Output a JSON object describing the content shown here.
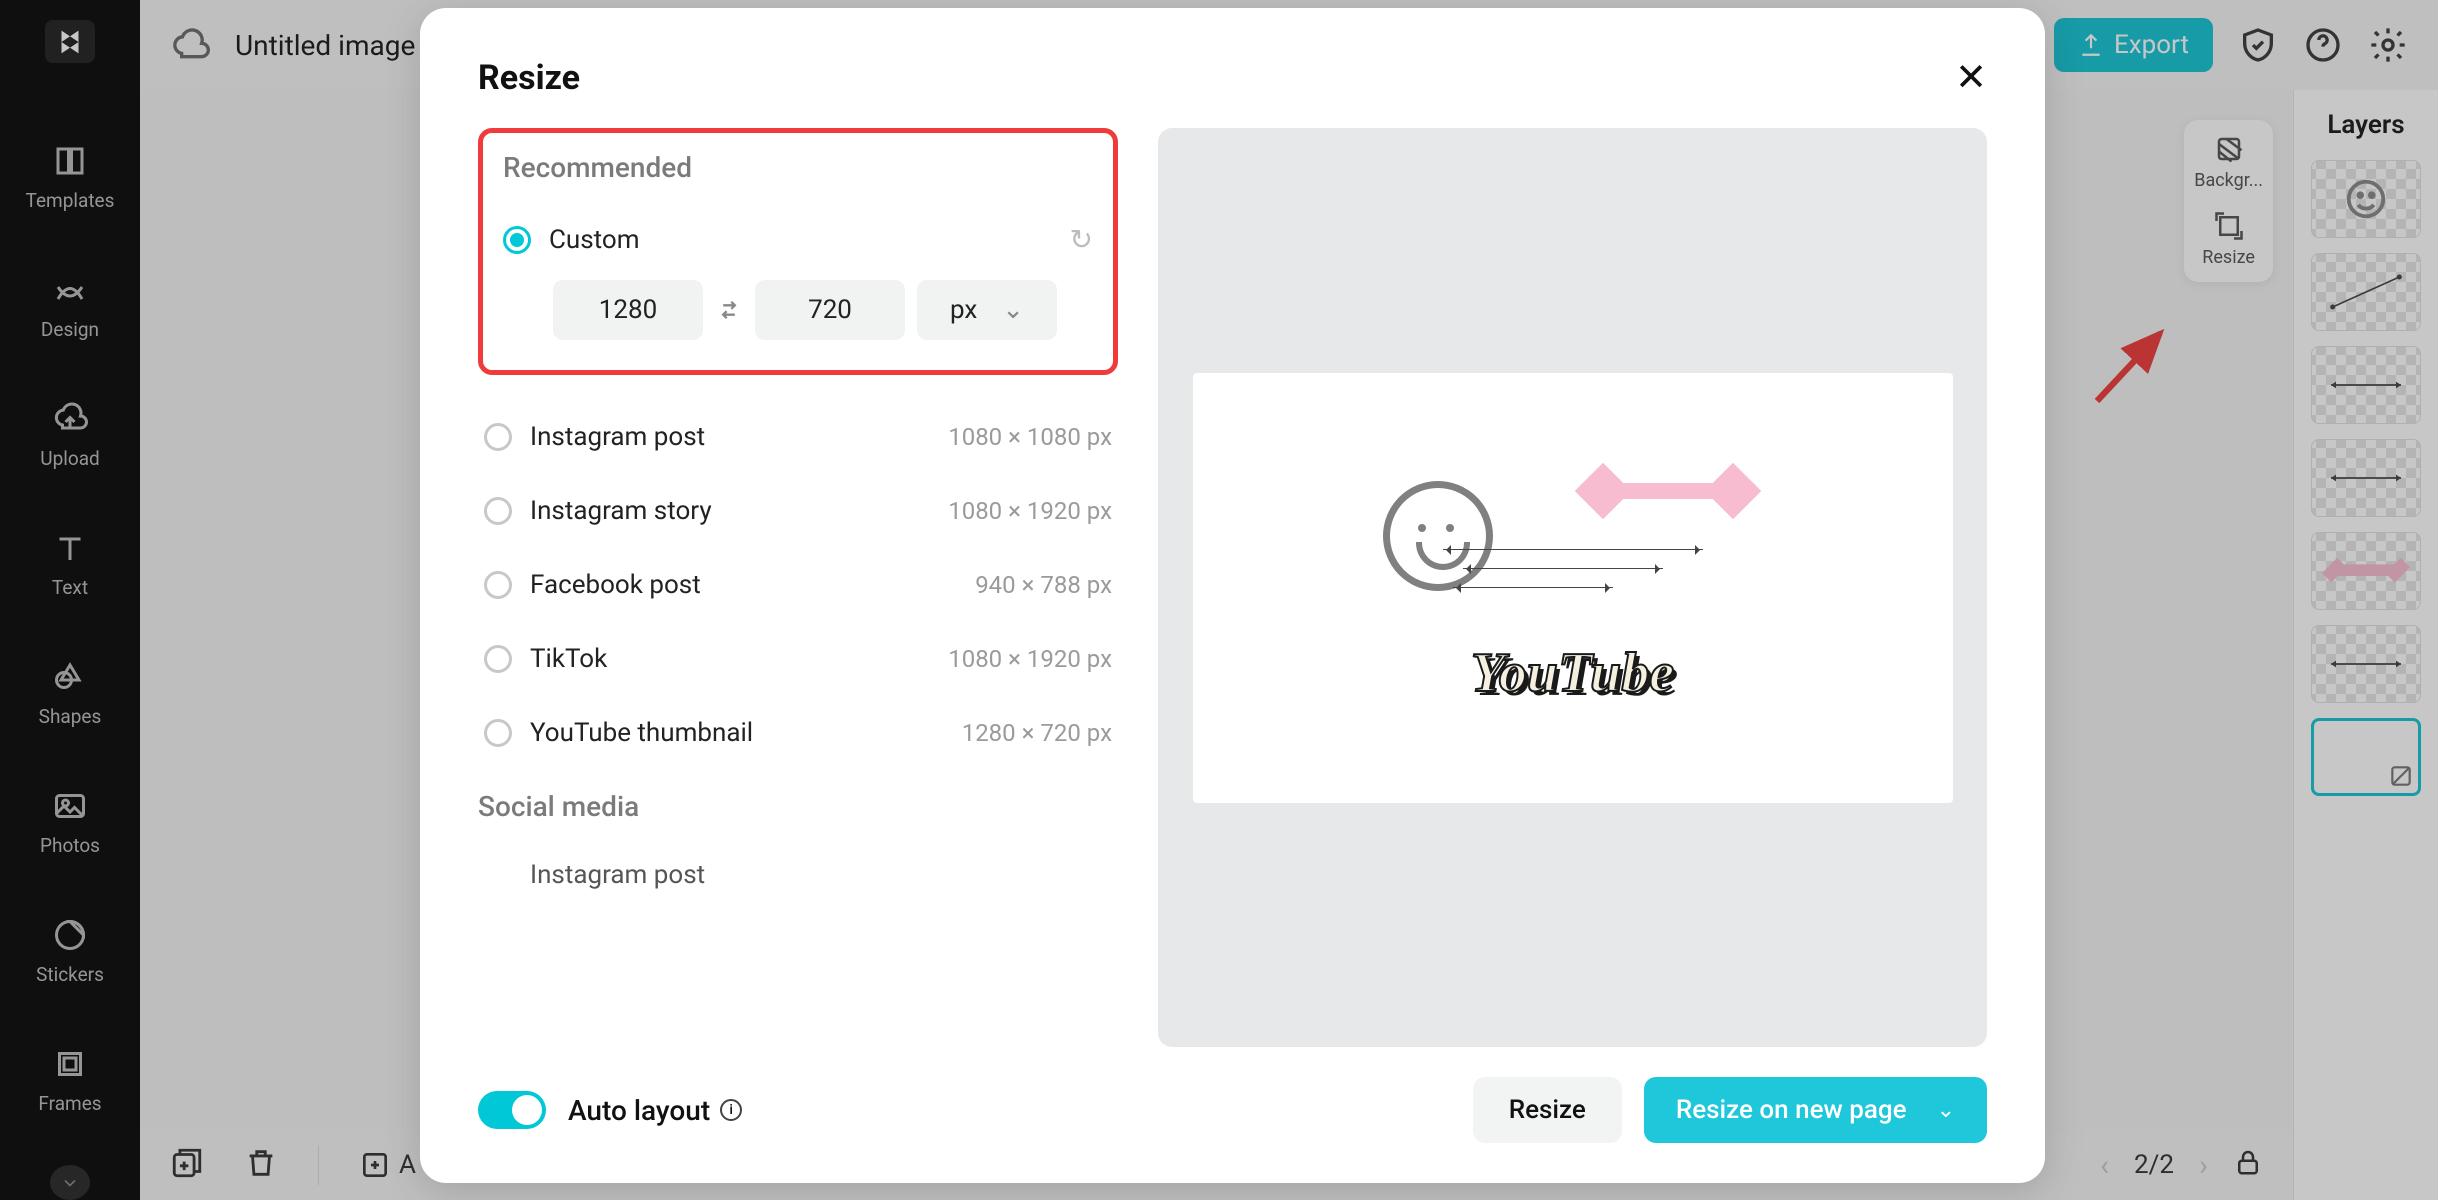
{
  "app": {
    "title": "Untitled image",
    "export_label": "Export"
  },
  "sidebar": {
    "items": [
      {
        "label": "Templates"
      },
      {
        "label": "Design"
      },
      {
        "label": "Upload"
      },
      {
        "label": "Text"
      },
      {
        "label": "Shapes"
      },
      {
        "label": "Photos"
      },
      {
        "label": "Stickers"
      },
      {
        "label": "Frames"
      }
    ]
  },
  "float_tools": {
    "background": "Backgr...",
    "resize": "Resize"
  },
  "layers_panel": {
    "title": "Layers"
  },
  "pager": {
    "current": "2",
    "total": "2",
    "display": "2/2"
  },
  "footer": {
    "add_label": "A"
  },
  "modal": {
    "title": "Resize",
    "recommended_heading": "Recommended",
    "custom_label": "Custom",
    "width_value": "1280",
    "height_value": "720",
    "unit": "px",
    "presets": [
      {
        "label": "Instagram post",
        "dims": "1080 × 1080 px"
      },
      {
        "label": "Instagram story",
        "dims": "1080 × 1920 px"
      },
      {
        "label": "Facebook post",
        "dims": "940 × 788 px"
      },
      {
        "label": "TikTok",
        "dims": "1080 × 1920 px"
      },
      {
        "label": "YouTube thumbnail",
        "dims": "1280 × 720 px"
      }
    ],
    "social_media_heading": "Social media",
    "social_media_items": [
      {
        "label": "Instagram post"
      }
    ],
    "preview_text": "YouTube",
    "auto_layout_label": "Auto layout",
    "resize_btn": "Resize",
    "resize_new_btn": "Resize on new page"
  }
}
